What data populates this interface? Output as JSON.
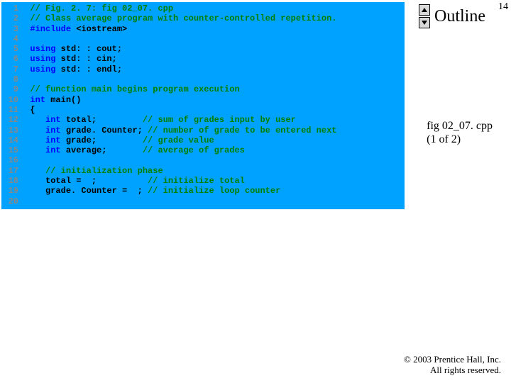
{
  "pagenum": "14",
  "outline": {
    "title": "Outline"
  },
  "sidebar": {
    "file": "fig 02_07. cpp",
    "part": "(1 of 2)"
  },
  "copyright": {
    "line1": "© 2003 Prentice Hall, Inc.",
    "line2": "All rights reserved."
  },
  "code": {
    "lines": [
      {
        "n": "1",
        "seg": [
          {
            "c": "cmt",
            "t": "// Fig. 2. 7: fig 02_07. cpp"
          }
        ]
      },
      {
        "n": "2",
        "seg": [
          {
            "c": "cmt",
            "t": "// Class average program with counter-controlled repetition."
          }
        ]
      },
      {
        "n": "3",
        "seg": [
          {
            "c": "kw",
            "t": "#include "
          },
          {
            "c": "pl",
            "t": "<iostream>"
          }
        ]
      },
      {
        "n": "4",
        "seg": []
      },
      {
        "n": "5",
        "seg": [
          {
            "c": "kw",
            "t": "using "
          },
          {
            "c": "pl",
            "t": "std: : cout;"
          }
        ]
      },
      {
        "n": "6",
        "seg": [
          {
            "c": "kw",
            "t": "using "
          },
          {
            "c": "pl",
            "t": "std: : cin;"
          }
        ]
      },
      {
        "n": "7",
        "seg": [
          {
            "c": "kw",
            "t": "using "
          },
          {
            "c": "pl",
            "t": "std: : endl;"
          }
        ]
      },
      {
        "n": "8",
        "seg": []
      },
      {
        "n": "9",
        "seg": [
          {
            "c": "cmt",
            "t": "// function main begins program execution"
          }
        ]
      },
      {
        "n": "10",
        "seg": [
          {
            "c": "kw",
            "t": "int"
          },
          {
            "c": "pl",
            "t": " main()"
          }
        ]
      },
      {
        "n": "11",
        "seg": [
          {
            "c": "pl",
            "t": "{"
          }
        ]
      },
      {
        "n": "12",
        "seg": [
          {
            "c": "pl",
            "t": "   "
          },
          {
            "c": "kw",
            "t": "int"
          },
          {
            "c": "pl",
            "t": " total;         "
          },
          {
            "c": "cmt",
            "t": "// sum of grades input by user"
          }
        ]
      },
      {
        "n": "13",
        "seg": [
          {
            "c": "pl",
            "t": "   "
          },
          {
            "c": "kw",
            "t": "int"
          },
          {
            "c": "pl",
            "t": " grade. Counter; "
          },
          {
            "c": "cmt",
            "t": "// number of grade to be entered next"
          }
        ]
      },
      {
        "n": "14",
        "seg": [
          {
            "c": "pl",
            "t": "   "
          },
          {
            "c": "kw",
            "t": "int"
          },
          {
            "c": "pl",
            "t": " grade;         "
          },
          {
            "c": "cmt",
            "t": "// grade value"
          }
        ]
      },
      {
        "n": "15",
        "seg": [
          {
            "c": "pl",
            "t": "   "
          },
          {
            "c": "kw",
            "t": "int"
          },
          {
            "c": "pl",
            "t": " average;       "
          },
          {
            "c": "cmt",
            "t": "// average of grades"
          }
        ]
      },
      {
        "n": "16",
        "seg": []
      },
      {
        "n": "17",
        "seg": [
          {
            "c": "pl",
            "t": "   "
          },
          {
            "c": "cmt",
            "t": "// initialization phase"
          }
        ]
      },
      {
        "n": "18",
        "seg": [
          {
            "c": "pl",
            "t": "   total =  ;          "
          },
          {
            "c": "cmt",
            "t": "// initialize total"
          }
        ]
      },
      {
        "n": "19",
        "seg": [
          {
            "c": "pl",
            "t": "   grade. Counter =  ; "
          },
          {
            "c": "cmt",
            "t": "// initialize loop counter"
          }
        ]
      },
      {
        "n": "20",
        "seg": []
      }
    ]
  }
}
